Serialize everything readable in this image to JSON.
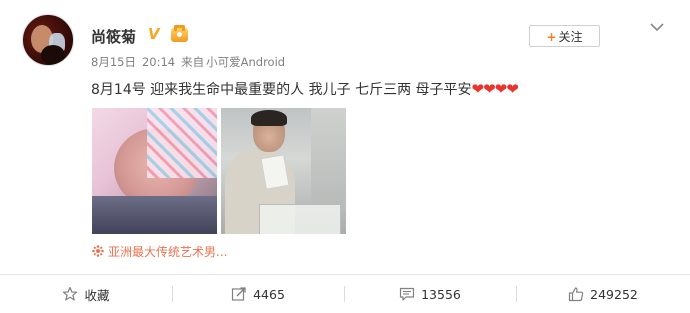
{
  "user": {
    "name": "尚筱菊",
    "verified_badge": "V"
  },
  "meta": {
    "date": "8月15日",
    "time": "20:14",
    "source_prefix": "来自",
    "source": "小可爱Android"
  },
  "follow_button": {
    "plus": "+",
    "label": "关注"
  },
  "post": {
    "text": "8月14号 迎来我生命中最重要的人 我儿子 七斤三两 母子平安",
    "hearts": "❤❤❤❤"
  },
  "location": {
    "label": "亚洲最大传统艺术男..."
  },
  "actions": [
    {
      "name": "favorite",
      "icon": "star-icon",
      "label": "收藏"
    },
    {
      "name": "repost",
      "icon": "repost-icon",
      "label": "4465"
    },
    {
      "name": "comment",
      "icon": "comment-icon",
      "label": "13556"
    },
    {
      "name": "like",
      "icon": "thumbs-up-icon",
      "label": "249252"
    }
  ],
  "colors": {
    "accent_orange": "#f77f2b",
    "location_red": "#eb7350",
    "heart_red": "#e8342c",
    "badge_gold": "#f5a623"
  }
}
